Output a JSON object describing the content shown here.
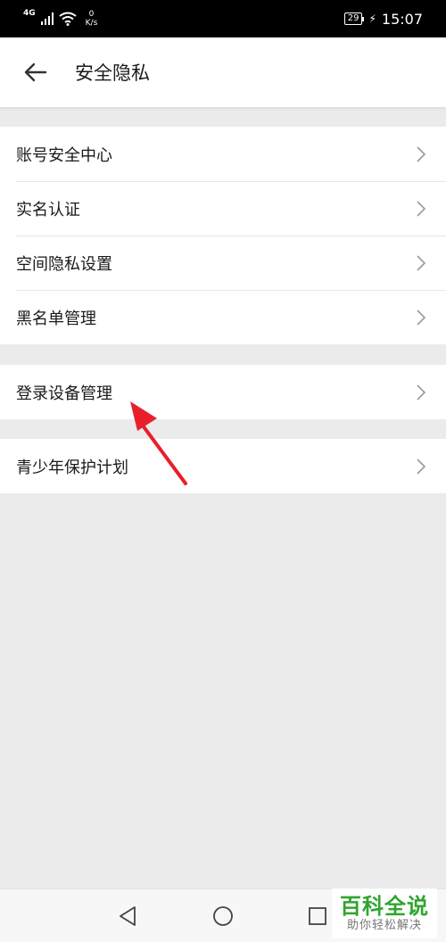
{
  "status_bar": {
    "network": "4G",
    "speed_value": "0",
    "speed_unit": "K/s",
    "battery": "29",
    "time": "15:07"
  },
  "header": {
    "title": "安全隐私",
    "back_icon": "arrow-left-icon"
  },
  "groups": [
    {
      "items": [
        {
          "label": "账号安全中心"
        },
        {
          "label": "实名认证"
        },
        {
          "label": "空间隐私设置"
        },
        {
          "label": "黑名单管理"
        }
      ]
    },
    {
      "items": [
        {
          "label": "登录设备管理"
        }
      ]
    },
    {
      "items": [
        {
          "label": "青少年保护计划"
        }
      ]
    }
  ],
  "navigation": {
    "back_icon": "triangle-back-icon",
    "home_icon": "circle-home-icon",
    "recents_icon": "square-recents-icon"
  },
  "watermark": {
    "main": "百科全说",
    "sub": "助你轻松解决"
  },
  "colors": {
    "background": "#ebebeb",
    "surface": "#ffffff",
    "annotation_arrow": "#e8202a",
    "watermark_green": "#2fa52f"
  }
}
